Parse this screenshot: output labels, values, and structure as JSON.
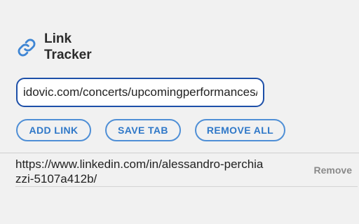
{
  "app": {
    "title_line1": "Link",
    "title_line2": "Tracker",
    "icon": "link-icon",
    "accent_color": "#2f78c8",
    "input_border_color": "#1d4fa8"
  },
  "url_input": {
    "value": "idovic.com/concerts/upcomingperformances/"
  },
  "buttons": {
    "add_link": "ADD LINK",
    "save_tab": "SAVE TAB",
    "remove_all": "REMOVE ALL"
  },
  "links": [
    {
      "url": "https://www.linkedin.com/in/alessandro-perchiazzi-5107a412b/",
      "remove_label": "Remove"
    }
  ]
}
